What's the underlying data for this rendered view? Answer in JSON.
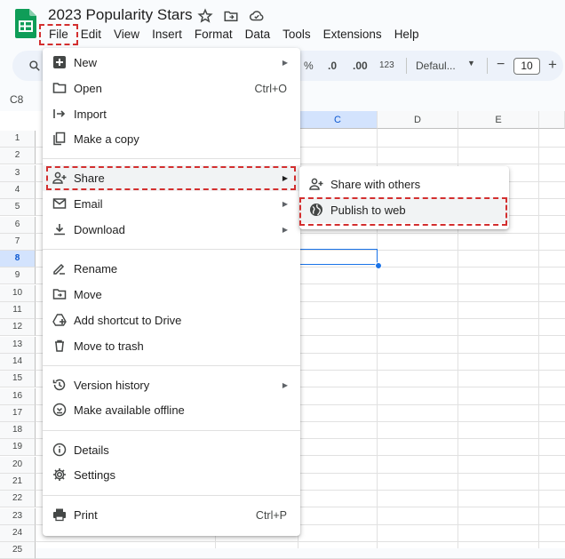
{
  "app": {
    "title": "2023 Popularity Stars"
  },
  "menubar": [
    "File",
    "Edit",
    "View",
    "Insert",
    "Format",
    "Data",
    "Tools",
    "Extensions",
    "Help"
  ],
  "toolbar": {
    "percent": "%",
    "dec_decrease": ".0",
    "dec_increase": ".00",
    "number_format": "123",
    "font": "Defaul...",
    "font_size": "10",
    "minus": "−",
    "plus": "+"
  },
  "namebox": "C8",
  "columns": [
    "C",
    "D",
    "E"
  ],
  "rows": [
    "1",
    "2",
    "3",
    "4",
    "5",
    "6",
    "7",
    "8",
    "9",
    "10",
    "11",
    "12",
    "13",
    "14",
    "15",
    "16",
    "17",
    "18",
    "19",
    "20",
    "21",
    "22",
    "23",
    "24",
    "25"
  ],
  "file_menu": {
    "new": "New",
    "open": "Open",
    "open_shortcut": "Ctrl+O",
    "import": "Import",
    "make_copy": "Make a copy",
    "share": "Share",
    "email": "Email",
    "download": "Download",
    "rename": "Rename",
    "move": "Move",
    "add_shortcut": "Add shortcut to Drive",
    "move_trash": "Move to trash",
    "version_history": "Version history",
    "offline": "Make available offline",
    "details": "Details",
    "settings": "Settings",
    "print": "Print",
    "print_shortcut": "Ctrl+P",
    "submenu_arrow": "▶"
  },
  "share_submenu": {
    "share_others": "Share with others",
    "publish_web": "Publish to web"
  },
  "colors": {
    "sheets_green": "#0f9d58",
    "highlight_red": "#d32f2f",
    "selection_blue": "#1a73e8"
  }
}
